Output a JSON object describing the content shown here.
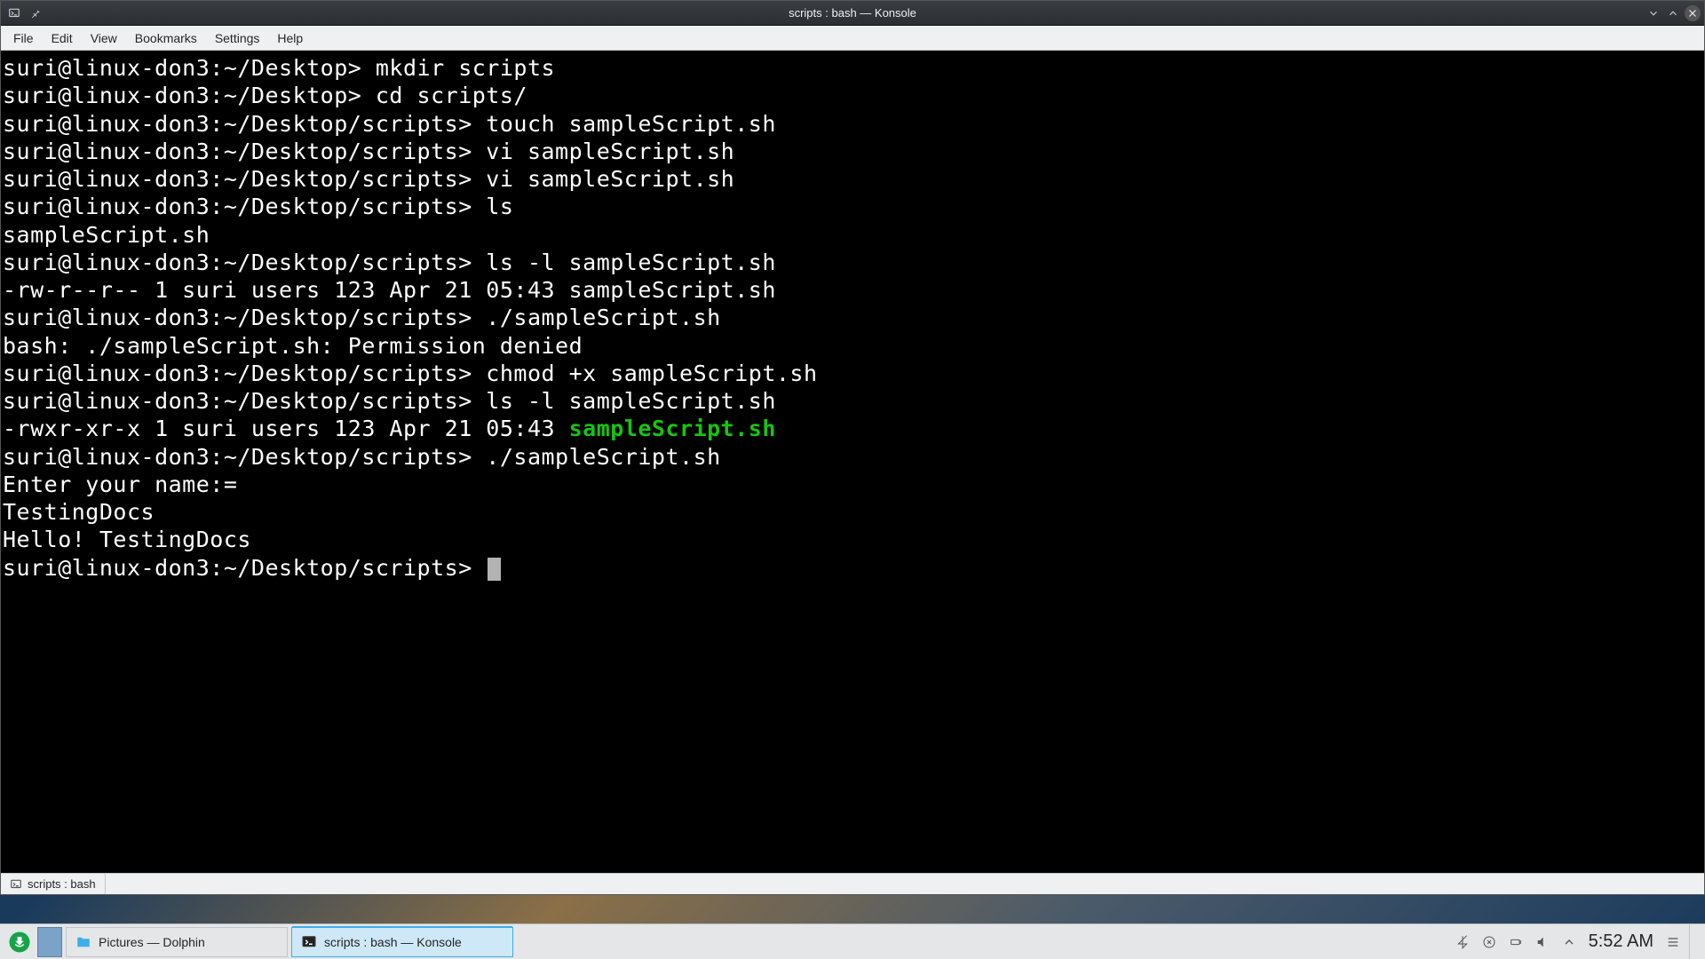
{
  "window": {
    "title": "scripts : bash — Konsole"
  },
  "menubar": {
    "items": [
      "File",
      "Edit",
      "View",
      "Bookmarks",
      "Settings",
      "Help"
    ]
  },
  "terminal": {
    "prompt_desktop": "suri@linux-don3:~/Desktop> ",
    "prompt_scripts": "suri@linux-don3:~/Desktop/scripts> ",
    "lines": [
      {
        "prompt": "desktop",
        "cmd": "mkdir scripts"
      },
      {
        "prompt": "desktop",
        "cmd": "cd scripts/"
      },
      {
        "prompt": "scripts",
        "cmd": "touch sampleScript.sh"
      },
      {
        "prompt": "scripts",
        "cmd": "vi sampleScript.sh"
      },
      {
        "prompt": "scripts",
        "cmd": "vi sampleScript.sh"
      },
      {
        "prompt": "scripts",
        "cmd": "ls"
      },
      {
        "text": "sampleScript.sh"
      },
      {
        "prompt": "scripts",
        "cmd": "ls -l sampleScript.sh"
      },
      {
        "text": "-rw-r--r-- 1 suri users 123 Apr 21 05:43 sampleScript.sh"
      },
      {
        "prompt": "scripts",
        "cmd": "./sampleScript.sh"
      },
      {
        "text": "bash: ./sampleScript.sh: Permission denied"
      },
      {
        "prompt": "scripts",
        "cmd": "chmod +x sampleScript.sh"
      },
      {
        "prompt": "scripts",
        "cmd": "ls -l sampleScript.sh"
      },
      {
        "text_pre": "-rwxr-xr-x 1 suri users 123 Apr 21 05:43 ",
        "exec": "sampleScript.sh"
      },
      {
        "prompt": "scripts",
        "cmd": "./sampleScript.sh"
      },
      {
        "text": "Enter your name:="
      },
      {
        "text": "TestingDocs"
      },
      {
        "text": "Hello! TestingDocs"
      },
      {
        "prompt": "scripts",
        "cmd": "",
        "cursor": true
      }
    ]
  },
  "tab": {
    "label": "scripts : bash"
  },
  "taskbar": {
    "tasks": [
      {
        "label": "Pictures — Dolphin",
        "icon": "folder",
        "active": false
      },
      {
        "label": "scripts : bash — Konsole",
        "icon": "terminal",
        "active": true
      }
    ],
    "clock": "5:52 AM"
  }
}
